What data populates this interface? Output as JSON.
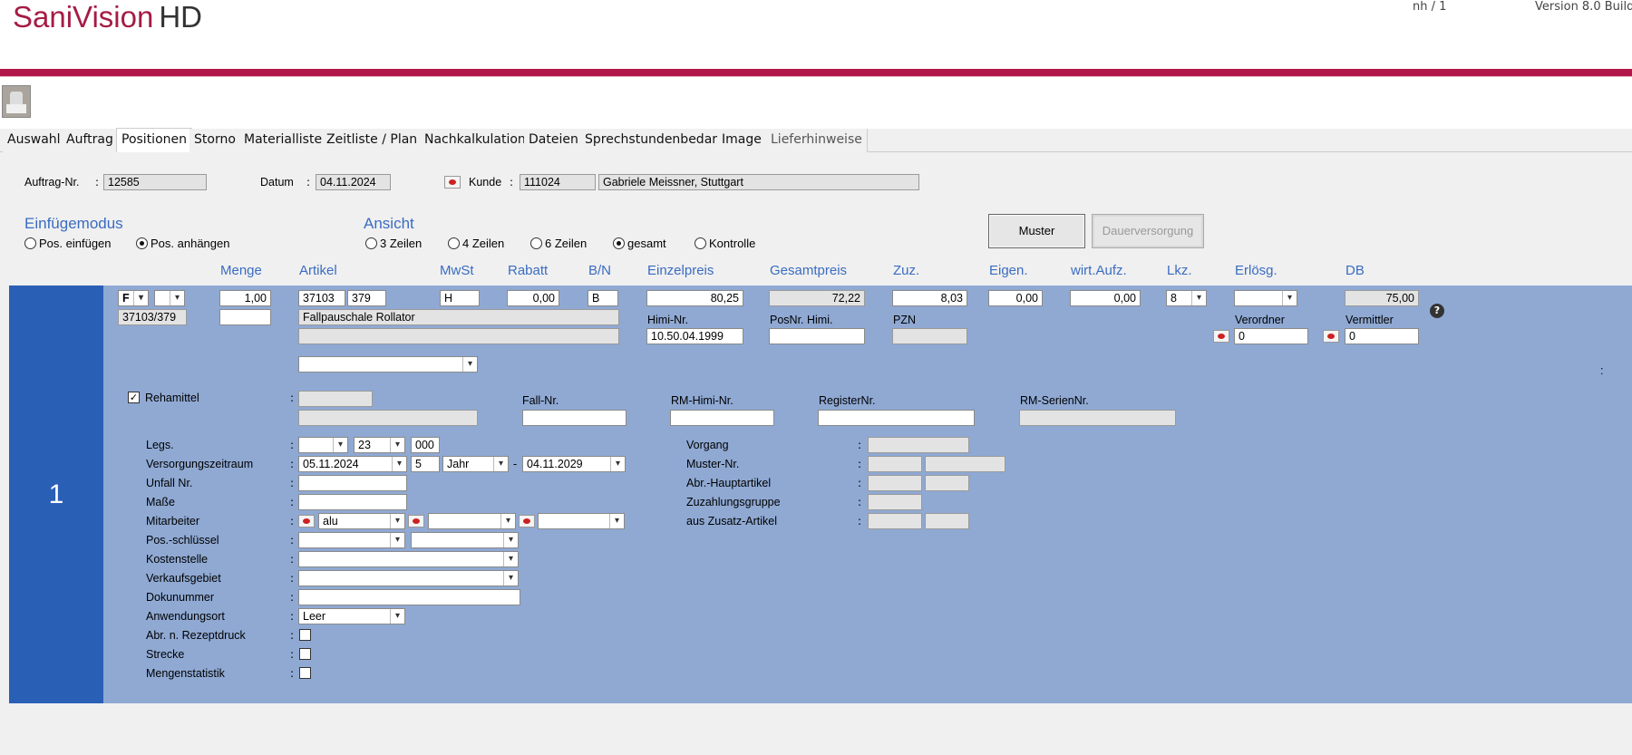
{
  "header": {
    "logo_main": "SaniVision",
    "logo_suffix": "HD",
    "user": "nh / 1",
    "version": "Version 8.0 Build"
  },
  "tabs": [
    {
      "label": "Auswahl"
    },
    {
      "label": "Auftrag"
    },
    {
      "label": "Positionen",
      "active": true
    },
    {
      "label": "Storno"
    },
    {
      "label": "Materialliste"
    },
    {
      "label": "Zeitliste / Plan"
    },
    {
      "label": "Nachkalkulation"
    },
    {
      "label": "Dateien"
    },
    {
      "label": "Sprechstundenbedarf"
    },
    {
      "label": "Image"
    },
    {
      "label": "Lieferhinweise"
    }
  ],
  "order": {
    "auftrag_label": "Auftrag-Nr.",
    "auftrag_value": "12585",
    "datum_label": "Datum",
    "datum_value": "04.11.2024",
    "kunde_label": "Kunde",
    "kunde_nr": "111024",
    "kunde_name": "Gabriele Meissner, Stuttgart"
  },
  "einfuege": {
    "title": "Einfügemodus",
    "opt1": "Pos. einfügen",
    "opt2": "Pos. anhängen",
    "selected": "Pos. anhängen"
  },
  "ansicht": {
    "title": "Ansicht",
    "opts": [
      "3 Zeilen",
      "4 Zeilen",
      "6 Zeilen",
      "gesamt",
      "Kontrolle"
    ],
    "selected": "gesamt"
  },
  "buttons": {
    "muster": "Muster",
    "dauer": "Dauerversorgung"
  },
  "columns": {
    "menge": "Menge",
    "artikel": "Artikel",
    "mwst": "MwSt",
    "rabatt": "Rabatt",
    "bn": "B/N",
    "einzelpreis": "Einzelpreis",
    "gesamtpreis": "Gesamtpreis",
    "zuz": "Zuz.",
    "eigen": "Eigen.",
    "wirt": "wirt.Aufz.",
    "lkz": "Lkz.",
    "erloesg": "Erlösg.",
    "db": "DB"
  },
  "position": {
    "number": "1",
    "type": "F",
    "code": "37103/379",
    "menge": "1,00",
    "artikel1": "37103",
    "artikel2": "379",
    "mwst": "H",
    "rabatt": "0,00",
    "bn": "B",
    "einzelpreis": "80,25",
    "gesamtpreis": "72,22",
    "zuz": "8,03",
    "eigen": "0,00",
    "wirt": "0,00",
    "lkz": "8",
    "db": "75,00",
    "bezeichnung": "Fallpauschale Rollator",
    "himi_label": "Himi-Nr.",
    "himi_value": "10.50.04.1999",
    "posnr_label": "PosNr. Himi.",
    "pzn_label": "PZN",
    "verordner_label": "Verordner",
    "verordner_value": "0",
    "vermittler_label": "Vermittler",
    "vermittler_value": "0",
    "help": "?",
    "colon_right": ":"
  },
  "reha": {
    "label": "Rehamittel",
    "fall_label": "Fall-Nr.",
    "rmhimi_label": "RM-Himi-Nr.",
    "register_label": "RegisterNr.",
    "rmserien_label": "RM-SerienNr."
  },
  "details": {
    "legs_label": "Legs.",
    "legs_v2": "23",
    "legs_v3": "000",
    "versorgung_label": "Versorgungszeitraum",
    "vers_from": "05.11.2024",
    "vers_n": "5",
    "vers_unit": "Jahr",
    "vers_dash": "-",
    "vers_to": "04.11.2029",
    "unfall_label": "Unfall Nr.",
    "masse_label": "Maße",
    "mitarbeiter_label": "Mitarbeiter",
    "mitarbeiter_value": "alu",
    "posschluessel_label": "Pos.-schlüssel",
    "kostenstelle_label": "Kostenstelle",
    "verkaufsgebiet_label": "Verkaufsgebiet",
    "dokunummer_label": "Dokunummer",
    "anwendungsort_label": "Anwendungsort",
    "anwendungsort_value": "Leer",
    "abr_label": "Abr. n. Rezeptdruck",
    "strecke_label": "Strecke",
    "mengenstat_label": "Mengenstatistik",
    "vorgang_label": "Vorgang",
    "muster_nr_label": "Muster-Nr.",
    "abr_haupt_label": "Abr.-Hauptartikel",
    "zuzahlung_label": "Zuzahlungsgruppe",
    "aus_zusatz_label": "aus Zusatz-Artikel"
  }
}
